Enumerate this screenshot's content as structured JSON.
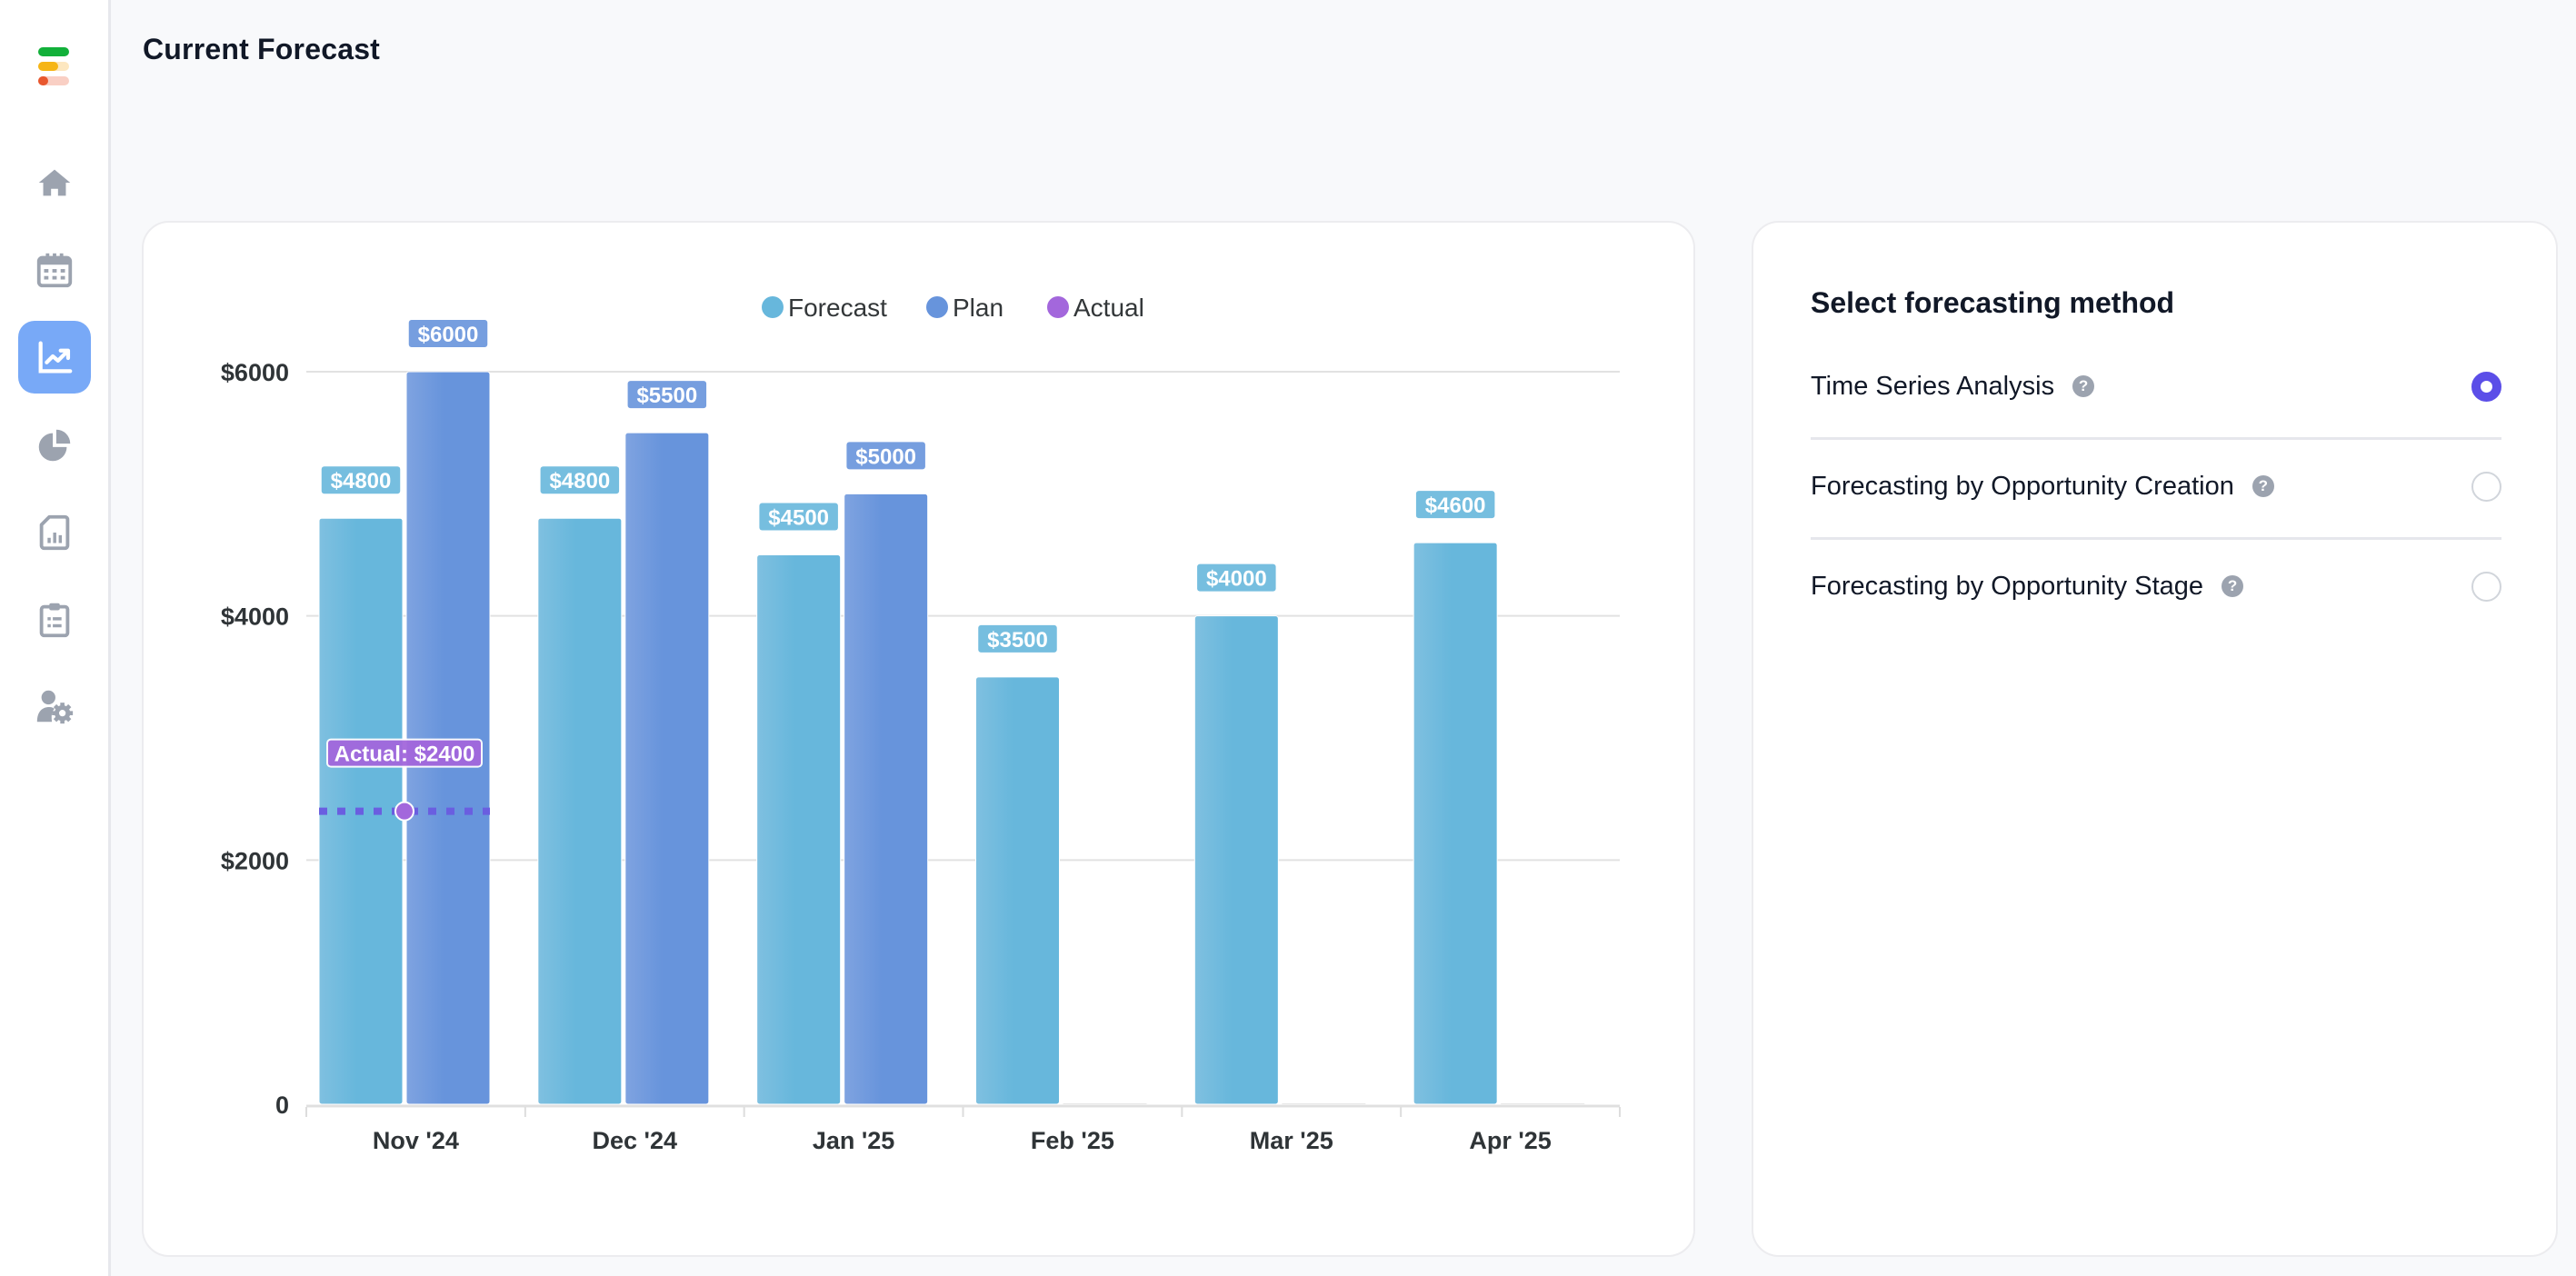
{
  "page": {
    "title": "Current Forecast"
  },
  "sidebar": {
    "logo": "app-logo",
    "items": [
      {
        "icon": "home-icon",
        "label": "Home",
        "active": false
      },
      {
        "icon": "calendar-icon",
        "label": "Calendar",
        "active": false
      },
      {
        "icon": "trend-chart-icon",
        "label": "Forecast",
        "active": true
      },
      {
        "icon": "pie-chart-icon",
        "label": "Analytics",
        "active": false
      },
      {
        "icon": "report-icon",
        "label": "Reports",
        "active": false
      },
      {
        "icon": "clipboard-icon",
        "label": "Tasks",
        "active": false
      },
      {
        "icon": "user-settings-icon",
        "label": "User Settings",
        "active": false
      }
    ]
  },
  "method_panel": {
    "title": "Select forecasting method",
    "options": [
      {
        "label": "Time Series Analysis",
        "selected": true,
        "help": "?"
      },
      {
        "label": "Forecasting by Opportunity Creation",
        "selected": false,
        "help": "?"
      },
      {
        "label": "Forecasting by Opportunity Stage",
        "selected": false,
        "help": "?"
      }
    ]
  },
  "colors": {
    "forecast": "#67b7dc",
    "plan": "#6794dc",
    "actual": "#a367dc",
    "actual_line": "#6a5ee0",
    "accent": "#5b4ee8",
    "active_nav": "#78a9f7"
  },
  "chart_data": {
    "type": "bar",
    "title": "",
    "xlabel": "",
    "ylabel": "",
    "ylim": [
      0,
      6000
    ],
    "yticks": [
      0,
      2000,
      4000,
      6000
    ],
    "ytick_labels": [
      "0",
      "$2000",
      "$4000",
      "$6000"
    ],
    "grid": true,
    "legend_position": "top-center",
    "categories": [
      "Nov '24",
      "Dec '24",
      "Jan '25",
      "Feb '25",
      "Mar '25",
      "Apr '25"
    ],
    "series": [
      {
        "name": "Forecast",
        "values": [
          4800,
          4800,
          4500,
          3500,
          4000,
          4600
        ],
        "labels": [
          "$4800",
          "$4800",
          "$4500",
          "$3500",
          "$4000",
          "$4600"
        ]
      },
      {
        "name": "Plan",
        "values": [
          6000,
          5500,
          5000,
          null,
          null,
          null
        ],
        "labels": [
          "$6000",
          "$5500",
          "$5000",
          null,
          null,
          null
        ]
      },
      {
        "name": "Actual",
        "values": [
          2400,
          null,
          null,
          null,
          null,
          null
        ],
        "labels": [
          "Actual: $2400",
          null,
          null,
          null,
          null,
          null
        ]
      }
    ]
  }
}
